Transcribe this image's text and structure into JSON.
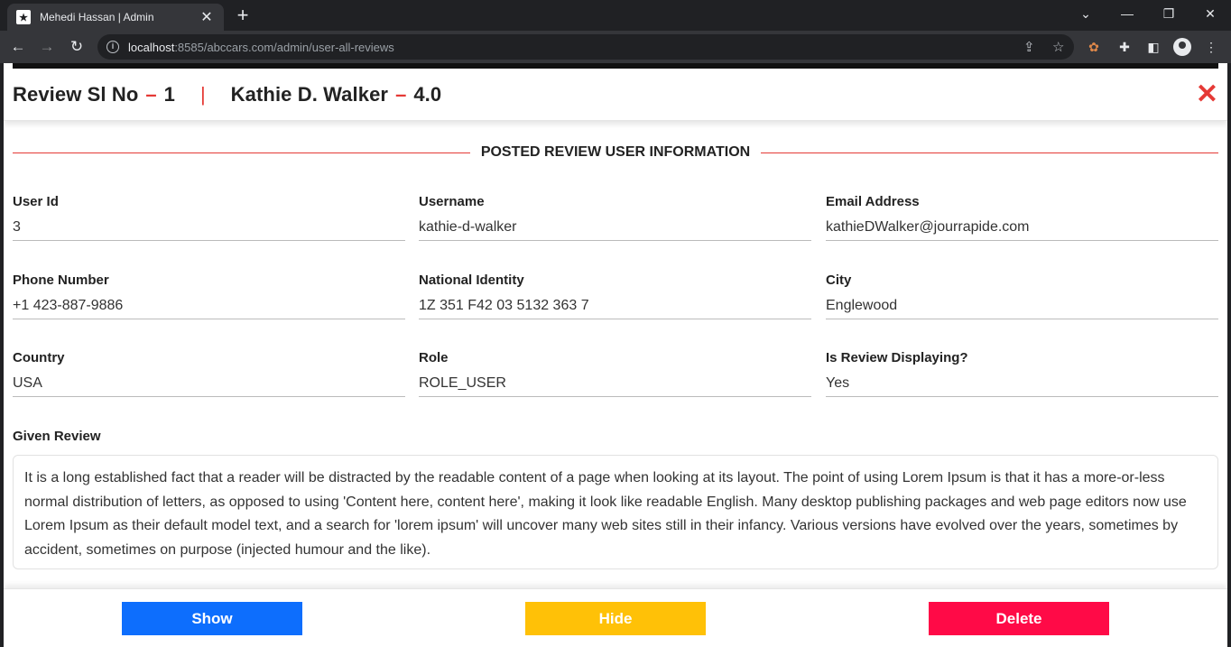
{
  "browser": {
    "tab_title": "Mehedi Hassan | Admin",
    "tab_close": "✕",
    "new_tab": "+",
    "url_host": "localhost",
    "url_rest": ":8585/abccars.com/admin/user-all-reviews",
    "icons": [
      "back-icon",
      "forward-icon",
      "reload-icon",
      "info-icon",
      "share-icon",
      "star-icon",
      "cookie-icon",
      "puzzle-icon",
      "sidepanel-icon",
      "profile-icon",
      "menu-icon"
    ]
  },
  "header": {
    "review_label": "Review Sl No",
    "review_no": "1",
    "reviewer_name": "Kathie D. Walker",
    "rating": "4.0",
    "dash": "–",
    "pipe": "|",
    "close": "✕"
  },
  "section_title": "POSTED REVIEW USER INFORMATION",
  "fields": [
    {
      "label": "User Id",
      "value": "3"
    },
    {
      "label": "Username",
      "value": "kathie-d-walker"
    },
    {
      "label": "Email Address",
      "value": "kathieDWalker@jourrapide.com"
    },
    {
      "label": "Phone Number",
      "value": "+1 423-887-9886"
    },
    {
      "label": "National Identity",
      "value": "1Z 351 F42 03 5132 363 7"
    },
    {
      "label": "City",
      "value": "Englewood"
    },
    {
      "label": "Country",
      "value": "USA"
    },
    {
      "label": "Role",
      "value": "ROLE_USER"
    },
    {
      "label": "Is Review Displaying?",
      "value": "Yes"
    }
  ],
  "review": {
    "label": "Given Review",
    "text": "It is a long established fact that a reader will be distracted by the readable content of a page when looking at its layout. The point of using Lorem Ipsum is that it has a more-or-less normal distribution of letters, as opposed to using 'Content here, content here', making it look like readable English. Many desktop publishing packages and web page editors now use Lorem Ipsum as their default model text, and a search for 'lorem ipsum' will uncover many web sites still in their infancy. Various versions have evolved over the years, sometimes by accident, sometimes on purpose (injected humour and the like)."
  },
  "buttons": {
    "show": "Show",
    "hide": "Hide",
    "delete": "Delete"
  },
  "colors": {
    "accent": "#e53935",
    "show": "#0d6efd",
    "hide": "#ffc107",
    "delete": "#ff0a47"
  }
}
